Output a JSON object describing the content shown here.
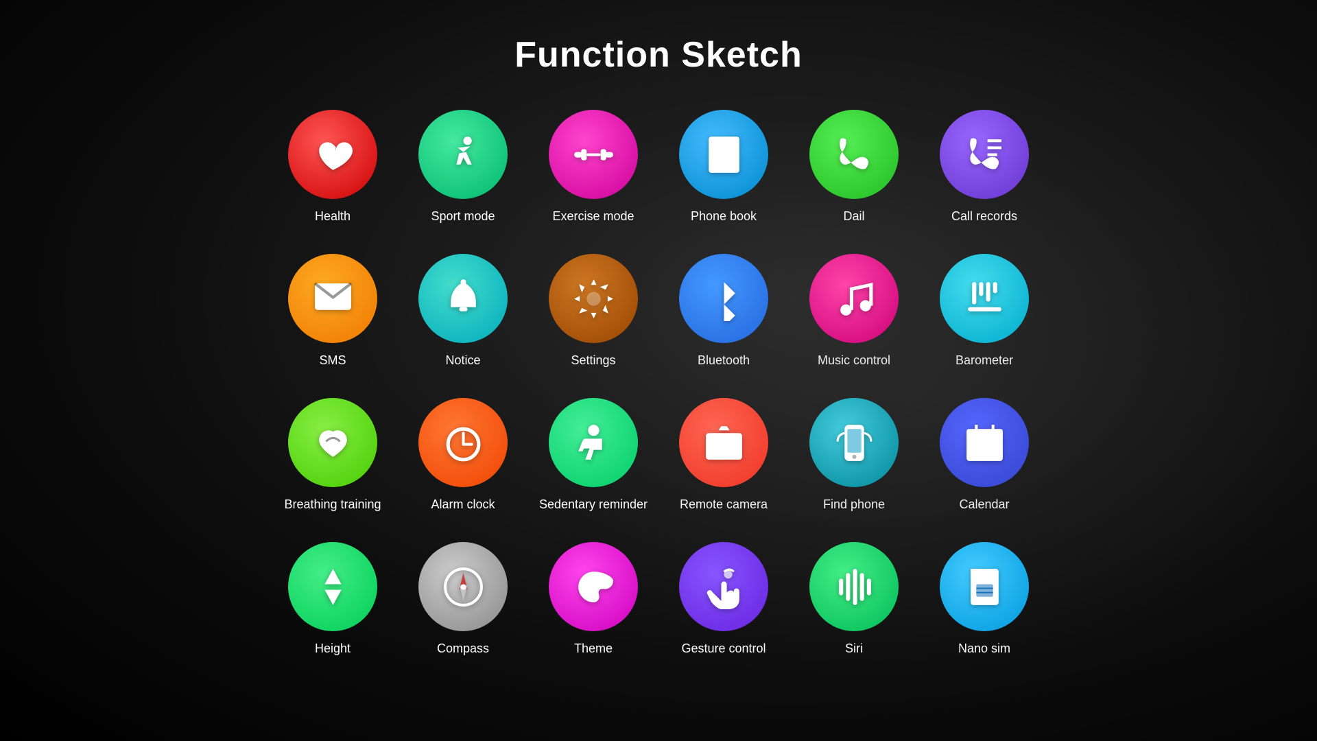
{
  "page": {
    "title": "Function Sketch"
  },
  "items": [
    {
      "id": "health",
      "label": "Health",
      "color": "bg-red",
      "icon": "health"
    },
    {
      "id": "sport-mode",
      "label": "Sport mode",
      "color": "bg-green-teal",
      "icon": "sport"
    },
    {
      "id": "exercise-mode",
      "label": "Exercise mode",
      "color": "bg-magenta",
      "icon": "exercise"
    },
    {
      "id": "phone-book",
      "label": "Phone book",
      "color": "bg-blue-light",
      "icon": "phonebook"
    },
    {
      "id": "dail",
      "label": "Dail",
      "color": "bg-green",
      "icon": "dial"
    },
    {
      "id": "call-records",
      "label": "Call records",
      "color": "bg-purple",
      "icon": "callrecords"
    },
    {
      "id": "sms",
      "label": "SMS",
      "color": "bg-orange",
      "icon": "sms"
    },
    {
      "id": "notice",
      "label": "Notice",
      "color": "bg-teal",
      "icon": "notice"
    },
    {
      "id": "settings",
      "label": "Settings",
      "color": "bg-brown",
      "icon": "settings"
    },
    {
      "id": "bluetooth",
      "label": "Bluetooth",
      "color": "bg-blue-mid",
      "icon": "bluetooth"
    },
    {
      "id": "music-control",
      "label": "Music control",
      "color": "bg-pink",
      "icon": "music"
    },
    {
      "id": "barometer",
      "label": "Barometer",
      "color": "bg-cyan",
      "icon": "barometer"
    },
    {
      "id": "breathing-training",
      "label": "Breathing training",
      "color": "bg-green2",
      "icon": "breathing"
    },
    {
      "id": "alarm-clock",
      "label": "Alarm clock",
      "color": "bg-orange2",
      "icon": "alarm"
    },
    {
      "id": "sedentary-reminder",
      "label": "Sedentary reminder",
      "color": "bg-green3",
      "icon": "sedentary"
    },
    {
      "id": "remote-camera",
      "label": "Remote camera",
      "color": "bg-coral",
      "icon": "camera"
    },
    {
      "id": "find-phone",
      "label": "Find phone",
      "color": "bg-teal2",
      "icon": "findphone"
    },
    {
      "id": "calendar",
      "label": "Calendar",
      "color": "bg-blue-dark",
      "icon": "calendar"
    },
    {
      "id": "height",
      "label": "Height",
      "color": "bg-green4",
      "icon": "height"
    },
    {
      "id": "compass",
      "label": "Compass",
      "color": "bg-gray",
      "icon": "compass"
    },
    {
      "id": "theme",
      "label": "Theme",
      "color": "bg-pink2",
      "icon": "theme"
    },
    {
      "id": "gesture-control",
      "label": "Gesture control",
      "color": "bg-purple2",
      "icon": "gesture"
    },
    {
      "id": "siri",
      "label": "Siri",
      "color": "bg-green5",
      "icon": "siri"
    },
    {
      "id": "nano-sim",
      "label": "Nano sim",
      "color": "bg-cyan2",
      "icon": "nanosim"
    }
  ]
}
